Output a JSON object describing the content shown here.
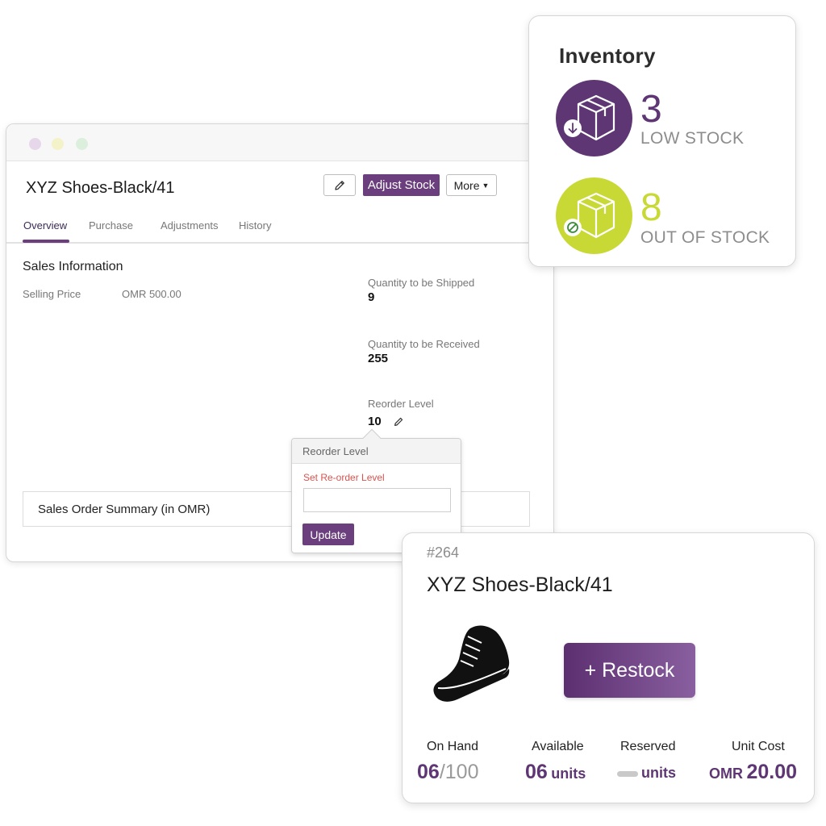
{
  "app": {
    "item_title": "XYZ Shoes-Black/41",
    "toolbar": {
      "adjust_stock_label": "Adjust Stock",
      "more_label": "More",
      "edit_icon": "pencil-icon",
      "more_icon": "caret-down-icon"
    },
    "tabs": [
      {
        "label": "Overview",
        "active": true
      },
      {
        "label": "Purchase",
        "active": false
      },
      {
        "label": "Adjustments",
        "active": false
      },
      {
        "label": "History",
        "active": false
      }
    ],
    "sales": {
      "section_title": "Sales Information",
      "selling_price_label": "Selling Price",
      "selling_price_value": "OMR 500.00"
    },
    "stats": {
      "to_ship_label": "Quantity to be Shipped",
      "to_ship_value": "9",
      "to_receive_label": "Quantity to be Received",
      "to_receive_value": "255",
      "reorder_label": "Reorder Level",
      "reorder_value": "10"
    },
    "summary_label": "Sales Order Summary (in OMR)",
    "reorder_popover": {
      "title": "Reorder Level",
      "field_label": "Set Re-order Level",
      "input_value": "",
      "update_label": "Update"
    }
  },
  "inventory": {
    "title": "Inventory",
    "low_stock": {
      "count": "3",
      "label": "LOW STOCK",
      "color": "#5e3673",
      "icon": "box-down-arrow-icon"
    },
    "out_of_stock": {
      "count": "8",
      "label": "OUT OF STOCK",
      "color": "#c8d936",
      "icon": "box-blocked-icon"
    }
  },
  "product_card": {
    "id": "#264",
    "name": "XYZ Shoes-Black/41",
    "image_icon": "sneaker-icon",
    "restock_label": "+ Restock",
    "on_hand": {
      "label": "On Hand",
      "value": "06",
      "total": "/100"
    },
    "available": {
      "label": "Available",
      "value": "06",
      "unit": "units"
    },
    "reserved": {
      "label": "Reserved",
      "unit": "units"
    },
    "unit_cost": {
      "label": "Unit Cost",
      "currency": "OMR",
      "value": "20.00"
    }
  },
  "colors": {
    "accent": "#6b3f7d",
    "lime": "#c8d936",
    "error": "#d9534f"
  }
}
